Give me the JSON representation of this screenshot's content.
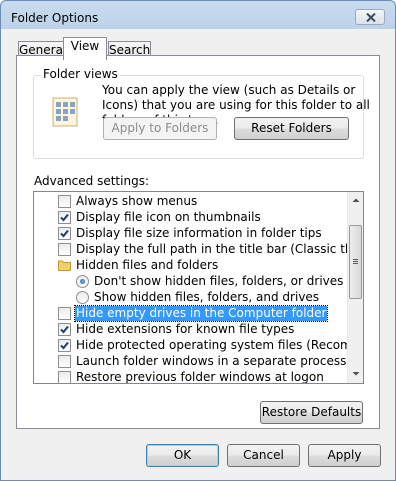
{
  "window": {
    "title": "Folder Options"
  },
  "tabs": [
    {
      "label": "General",
      "active": false
    },
    {
      "label": "View",
      "active": true
    },
    {
      "label": "Search",
      "active": false
    }
  ],
  "folder_views": {
    "group_label": "Folder views",
    "description": "You can apply the view (such as Details or Icons) that you are using for this folder to all folders of this type.",
    "apply_button": "Apply to Folders",
    "reset_button": "Reset Folders"
  },
  "advanced": {
    "label": "Advanced settings:",
    "items": [
      {
        "type": "checkbox",
        "label": "Always show menus",
        "checked": false
      },
      {
        "type": "checkbox",
        "label": "Display file icon on thumbnails",
        "checked": true
      },
      {
        "type": "checkbox",
        "label": "Display file size information in folder tips",
        "checked": true
      },
      {
        "type": "checkbox",
        "label": "Display the full path in the title bar (Classic theme only)",
        "checked": false
      },
      {
        "type": "folder",
        "label": "Hidden files and folders"
      },
      {
        "type": "radio",
        "label": "Don't show hidden files, folders, or drives",
        "checked": true
      },
      {
        "type": "radio",
        "label": "Show hidden files, folders, and drives",
        "checked": false
      },
      {
        "type": "checkbox",
        "label": "Hide empty drives in the Computer folder",
        "checked": false,
        "selected": true
      },
      {
        "type": "checkbox",
        "label": "Hide extensions for known file types",
        "checked": true
      },
      {
        "type": "checkbox",
        "label": "Hide protected operating system files (Recommended)",
        "checked": true
      },
      {
        "type": "checkbox",
        "label": "Launch folder windows in a separate process",
        "checked": false
      },
      {
        "type": "checkbox",
        "label": "Restore previous folder windows at logon",
        "checked": false
      }
    ],
    "restore_button": "Restore Defaults"
  },
  "footer": {
    "ok": "OK",
    "cancel": "Cancel",
    "apply": "Apply"
  },
  "colors": {
    "selection": "#3399ff",
    "title_bar": "#bdd2ea",
    "dialog_bg": "#f0f0f0"
  },
  "icons": [
    "close-icon",
    "folder-views-icon",
    "checkmark-icon",
    "folder-icon",
    "scroll-up-icon",
    "scroll-down-icon"
  ]
}
